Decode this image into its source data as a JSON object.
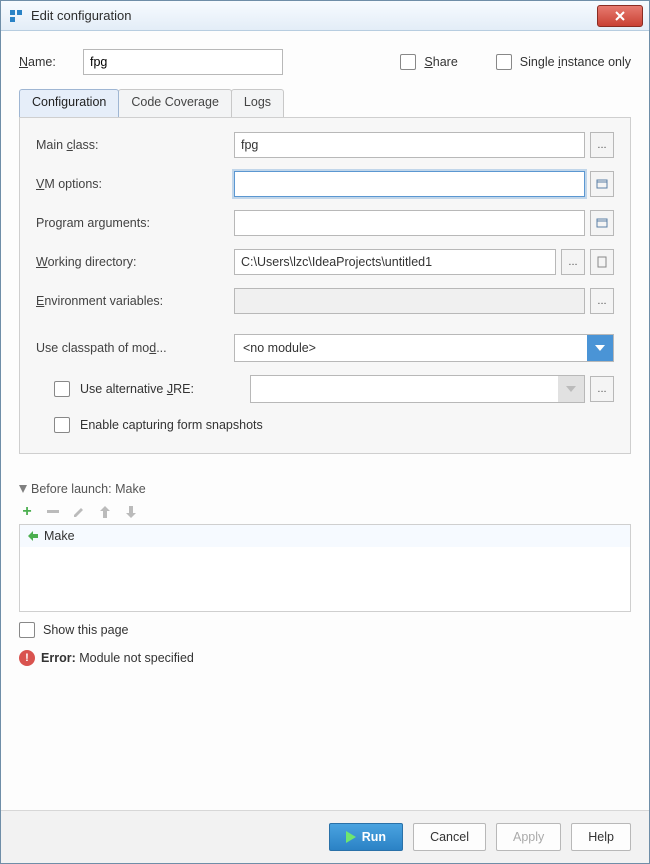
{
  "window": {
    "title": "Edit configuration"
  },
  "header": {
    "name_label": "Name:",
    "name_value": "fpg",
    "share_label": "Share",
    "single_instance_label": "Single instance only"
  },
  "tabs": [
    {
      "label": "Configuration",
      "active": true
    },
    {
      "label": "Code Coverage"
    },
    {
      "label": "Logs"
    }
  ],
  "form": {
    "main_class_label": "Main class:",
    "main_class_value": "fpg",
    "vm_options_label": "VM options:",
    "vm_options_value": "",
    "program_args_label": "Program arguments:",
    "program_args_value": "",
    "working_dir_label": "Working directory:",
    "working_dir_value": "C:\\Users\\lzc\\IdeaProjects\\untitled1",
    "env_vars_label": "Environment variables:",
    "env_vars_value": "",
    "classpath_label": "Use classpath of mod...",
    "classpath_value": "<no module>",
    "alt_jre_label": "Use alternative JRE:",
    "alt_jre_value": "",
    "enable_snapshots_label": "Enable capturing form snapshots",
    "ellipsis": "..."
  },
  "before_launch": {
    "title": "Before launch: Make",
    "items": [
      "Make"
    ],
    "show_this_page": "Show this page"
  },
  "error": {
    "prefix": "Error:",
    "message": " Module not specified"
  },
  "buttons": {
    "run": "Run",
    "cancel": "Cancel",
    "apply": "Apply",
    "help": "Help"
  }
}
